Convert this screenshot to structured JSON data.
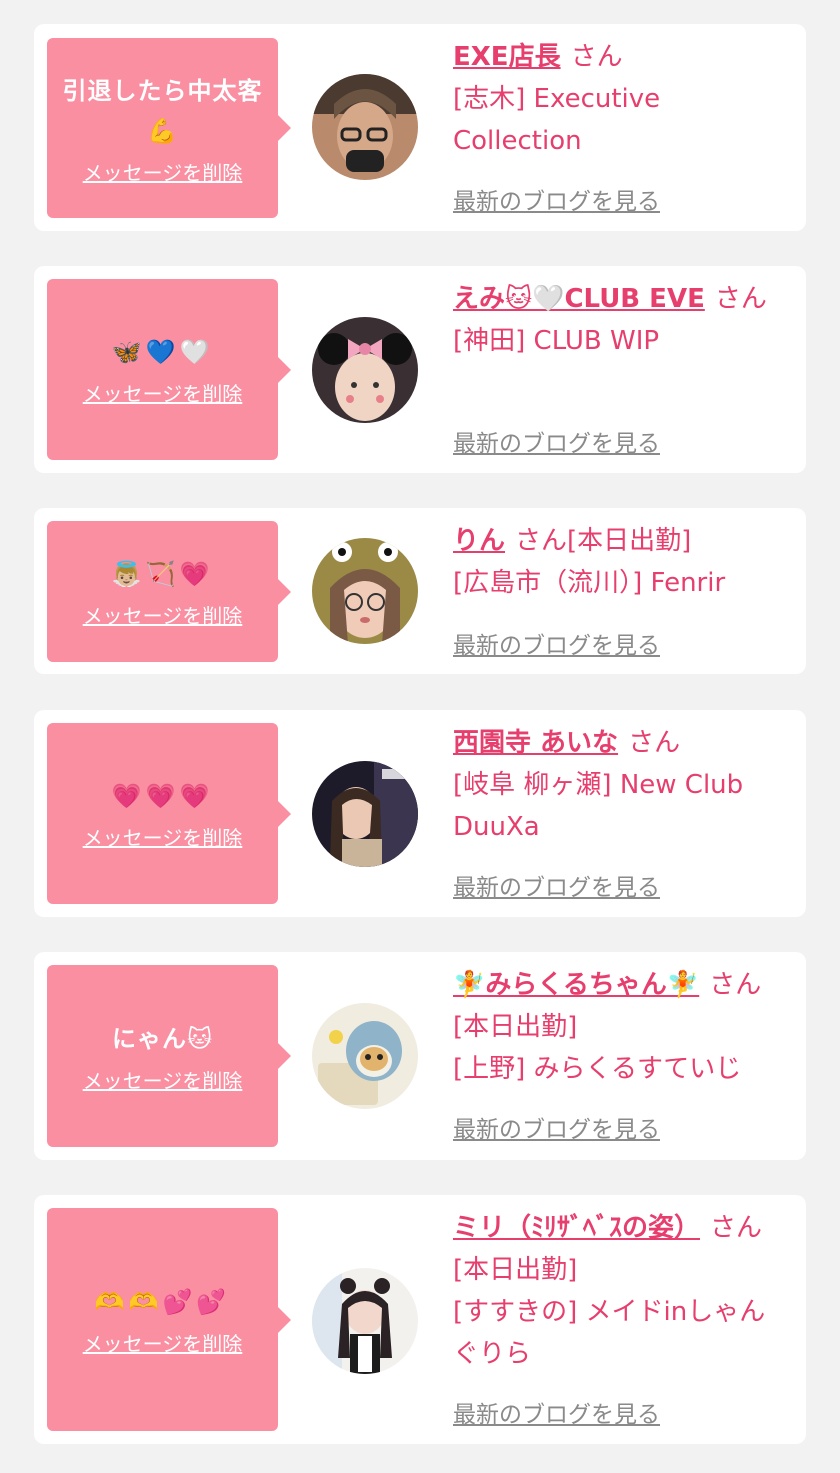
{
  "items": [
    {
      "memo": "引退したら中太客💪",
      "delete_label": "メッセージを削除",
      "name": "EXE店長",
      "name_suffix": "さん",
      "shop": "[志木] Executive Collection",
      "blog_label": "最新のブログを見る"
    },
    {
      "memo": "🦋💙🤍",
      "delete_label": "メッセージを削除",
      "name": "えみ🐱🤍CLUB EVE",
      "name_suffix": "さん",
      "shop": "[神田] CLUB WIP",
      "blog_label": "最新のブログを見る"
    },
    {
      "memo": "👼🏼🏹💗",
      "delete_label": "メッセージを削除",
      "name": "りん",
      "name_suffix": "さん[本日出勤]",
      "shop": "[広島市（流川）] Fenrir",
      "blog_label": "最新のブログを見る"
    },
    {
      "memo": "💗💗💗",
      "delete_label": "メッセージを削除",
      "name": "西園寺 あいな",
      "name_suffix": "さん",
      "shop": "[岐阜 柳ヶ瀬] New Club DuuXa",
      "blog_label": "最新のブログを見る"
    },
    {
      "memo": "にゃん🐱",
      "delete_label": "メッセージを削除",
      "name": "🧚みらくるちゃん🧚",
      "name_suffix": "さん[本日出勤]",
      "shop": "[上野] みらくるすていじ",
      "blog_label": "最新のブログを見る"
    },
    {
      "memo": "🫶🫶💕💕",
      "delete_label": "メッセージを削除",
      "name": "ミリ（ﾐﾘｻﾞﾍﾞｽの姿）",
      "name_suffix": "さん[本日出勤]",
      "shop": "[すすきの] メイドinしゃんぐりら",
      "blog_label": "最新のブログを見る"
    }
  ],
  "colors": {
    "background": "#f2f2f2",
    "card": "#ffffff",
    "memo_bubble": "#fa8fa2",
    "accent_text": "#e63e6d",
    "muted_link": "#8a8a8a"
  }
}
